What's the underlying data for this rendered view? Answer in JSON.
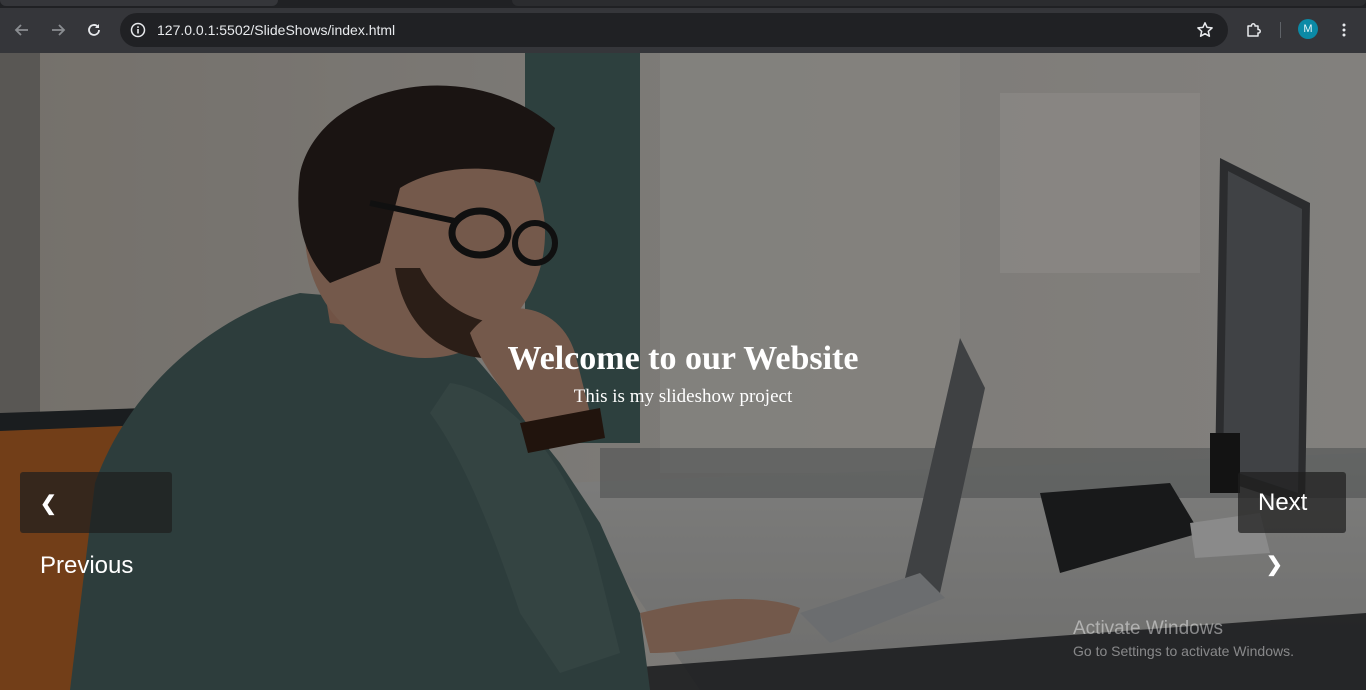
{
  "browser": {
    "url": "127.0.0.1:5502/SlideShows/index.html",
    "profile_initial": "M",
    "icons": {
      "back": "arrow-left-icon",
      "forward": "arrow-right-icon",
      "reload": "reload-icon",
      "site_info": "info-circle-icon",
      "bookmark": "star-icon",
      "extensions": "puzzle-icon",
      "menu": "kebab-menu-icon"
    }
  },
  "slide": {
    "title": "Welcome to our Website",
    "subtitle": "This is my slideshow project"
  },
  "controls": {
    "prev_label": "Previous",
    "next_label": "Next",
    "prev_chevron": "❮",
    "next_chevron": "❯"
  },
  "watermark": {
    "line1": "Activate Windows",
    "line2": "Go to Settings to activate Windows."
  }
}
